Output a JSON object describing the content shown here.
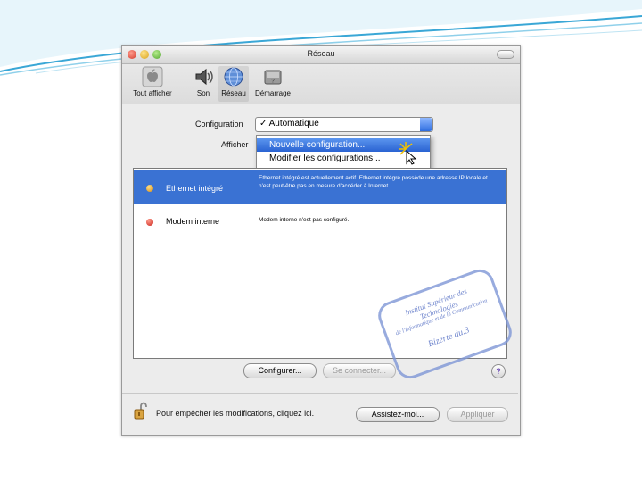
{
  "window": {
    "title": "Réseau"
  },
  "toolbar": {
    "items": [
      {
        "label": "Tout afficher"
      },
      {
        "label": "Son"
      },
      {
        "label": "Réseau"
      },
      {
        "label": "Démarrage"
      }
    ]
  },
  "config": {
    "configuration_label": "Configuration",
    "afficher_label": "Afficher",
    "selected": "✓ Automatique"
  },
  "menu": {
    "items": [
      {
        "label": "Nouvelle configuration..."
      },
      {
        "label": "Modifier les configurations..."
      }
    ]
  },
  "services": [
    {
      "name": "Ethernet intégré",
      "status_color": "#d58a10",
      "description": "Ethernet intégré est actuellement actif. Ethernet intégré possède une adresse IP locale et n'est peut-être pas en mesure d'accéder à Internet."
    },
    {
      "name": "Modem interne",
      "status_color": "#c9221a",
      "description": "Modem interne n'est pas configuré."
    }
  ],
  "stamp": {
    "line1": "Institut Supérieur des Technologies",
    "line2": "de l'Informatique et de la Communication",
    "line3": "Bizerte du.3"
  },
  "buttons": {
    "configure": "Configurer...",
    "connect": "Se connecter...",
    "help": "?",
    "assist": "Assistez-moi...",
    "apply": "Appliquer"
  },
  "lock": {
    "text": "Pour empêcher les modifications, cliquez ici."
  },
  "colors": {
    "selection": "#3a72d3",
    "menu_highlight": "#2a63d2",
    "slide_accent": "#3aa7d6"
  }
}
